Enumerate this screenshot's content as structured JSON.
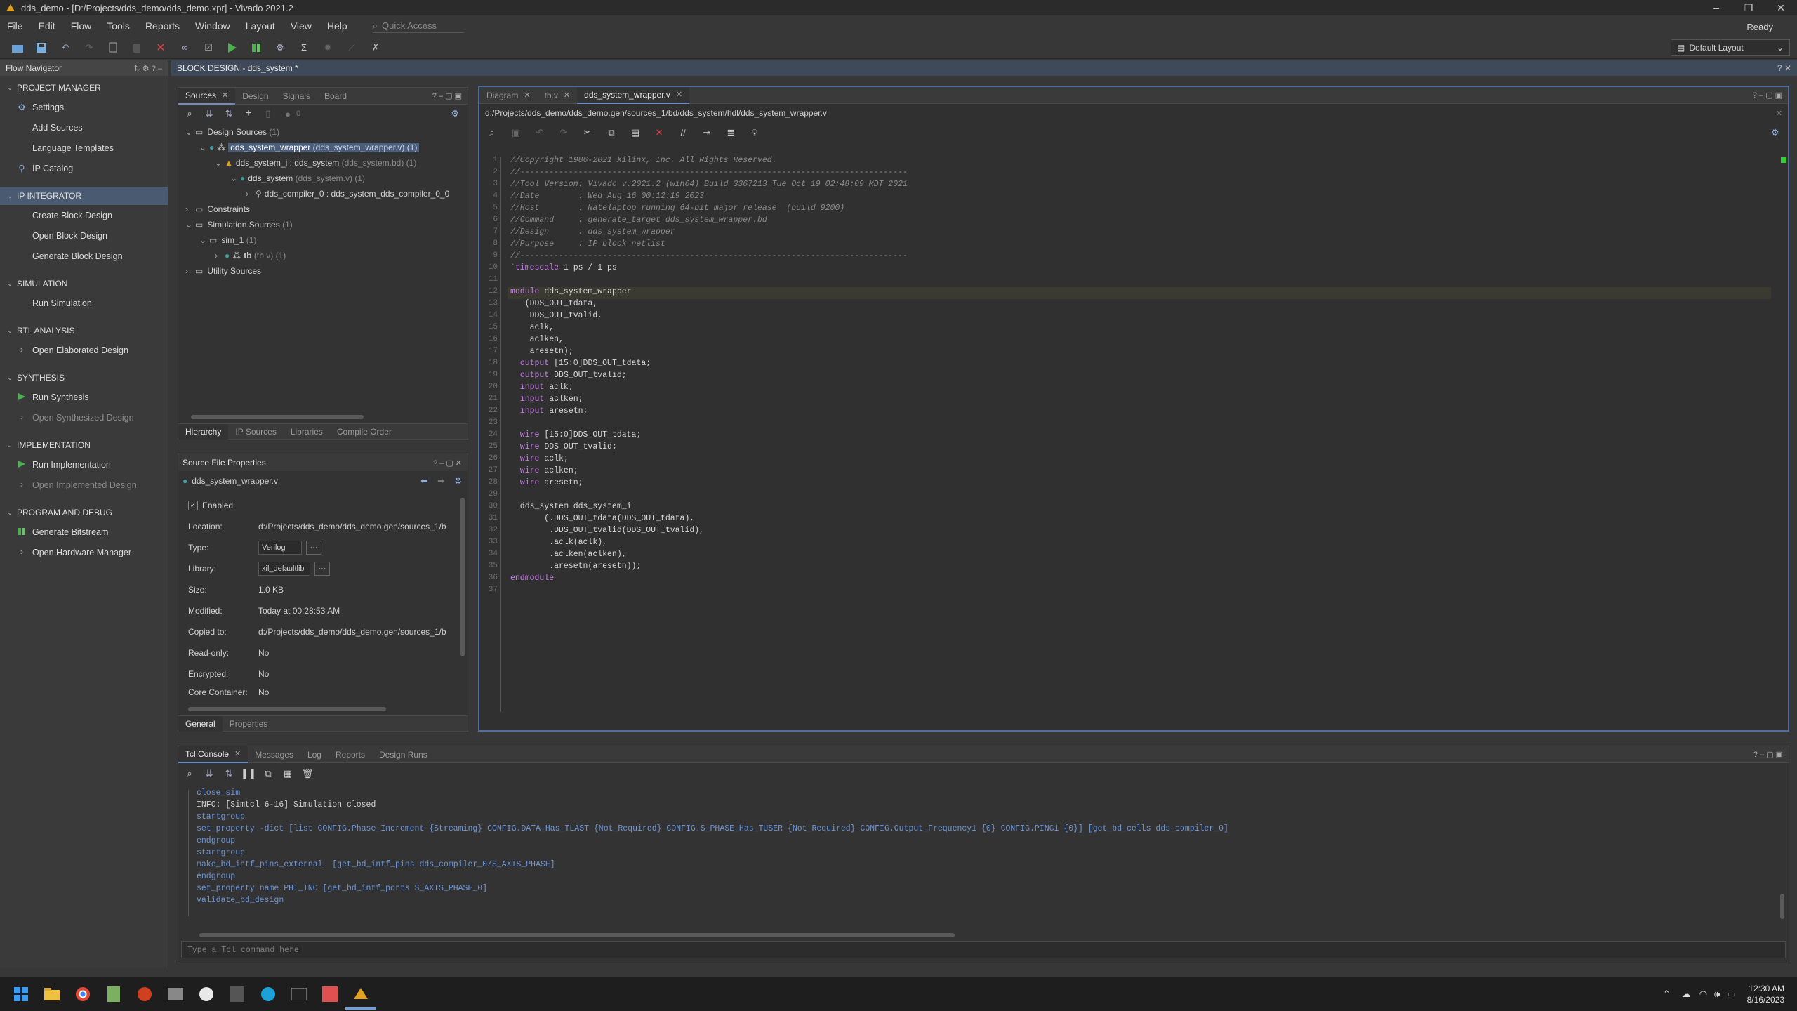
{
  "titlebar": {
    "title": "dds_demo - [D:/Projects/dds_demo/dds_demo.xpr] - Vivado 2021.2"
  },
  "menubar": {
    "items": [
      "File",
      "Edit",
      "Flow",
      "Tools",
      "Reports",
      "Window",
      "Layout",
      "View",
      "Help"
    ],
    "quick_access": "Quick Access",
    "status": "Ready"
  },
  "toolbar": {
    "layout_selector": "Default Layout"
  },
  "flow_navigator": {
    "title": "Flow Navigator",
    "sections": [
      {
        "title": "PROJECT MANAGER",
        "items": [
          "Settings",
          "Add Sources",
          "Language Templates",
          "IP Catalog"
        ]
      },
      {
        "title": "IP INTEGRATOR",
        "items": [
          "Create Block Design",
          "Open Block Design",
          "Generate Block Design"
        ]
      },
      {
        "title": "SIMULATION",
        "items": [
          "Run Simulation"
        ]
      },
      {
        "title": "RTL ANALYSIS",
        "items": [
          "Open Elaborated Design"
        ]
      },
      {
        "title": "SYNTHESIS",
        "items": [
          "Run Synthesis",
          "Open Synthesized Design"
        ]
      },
      {
        "title": "IMPLEMENTATION",
        "items": [
          "Run Implementation",
          "Open Implemented Design"
        ]
      },
      {
        "title": "PROGRAM AND DEBUG",
        "items": [
          "Generate Bitstream",
          "Open Hardware Manager"
        ]
      }
    ]
  },
  "block_design": {
    "header": "BLOCK DESIGN - dds_system *"
  },
  "sources": {
    "tabs": [
      "Sources",
      "Design",
      "Signals",
      "Board"
    ],
    "badge": "0",
    "tree": {
      "design_sources": "Design Sources",
      "design_sources_count": "(1)",
      "wrapper_name": "dds_system_wrapper",
      "wrapper_file": "(dds_system_wrapper.v) (1)",
      "inst_name": "dds_system_i : dds_system",
      "inst_file": "(dds_system.bd) (1)",
      "sys_name": "dds_system",
      "sys_file": "(dds_system.v) (1)",
      "comp_name": "dds_compiler_0 : dds_system_dds_compiler_0_0",
      "constraints": "Constraints",
      "sim_sources": "Simulation Sources",
      "sim_sources_count": "(1)",
      "sim_1": "sim_1",
      "sim_1_count": "(1)",
      "tb_name": "tb",
      "tb_file": "(tb.v) (1)",
      "utility": "Utility Sources"
    },
    "bottom_tabs": [
      "Hierarchy",
      "IP Sources",
      "Libraries",
      "Compile Order"
    ]
  },
  "props": {
    "title": "Source File Properties",
    "file": "dds_system_wrapper.v",
    "enabled": "Enabled",
    "rows": [
      {
        "k": "Location:",
        "v": "d:/Projects/dds_demo/dds_demo.gen/sources_1/b"
      },
      {
        "k": "Type:",
        "v": "Verilog"
      },
      {
        "k": "Library:",
        "v": "xil_defaultlib"
      },
      {
        "k": "Size:",
        "v": "1.0 KB"
      },
      {
        "k": "Modified:",
        "v": "Today at 00:28:53 AM"
      },
      {
        "k": "Copied to:",
        "v": "d:/Projects/dds_demo/dds_demo.gen/sources_1/b"
      },
      {
        "k": "Read-only:",
        "v": "No"
      },
      {
        "k": "Encrypted:",
        "v": "No"
      },
      {
        "k": "Core Container:",
        "v": "No"
      }
    ],
    "bottom_tabs": [
      "General",
      "Properties"
    ]
  },
  "editor": {
    "tabs": [
      "Diagram",
      "tb.v",
      "dds_system_wrapper.v"
    ],
    "path": "d:/Projects/dds_demo/dds_demo.gen/sources_1/bd/dds_system/hdl/dds_system_wrapper.v",
    "lines": [
      "//Copyright 1986-2021 Xilinx, Inc. All Rights Reserved.",
      "//--------------------------------------------------------------------------------",
      "//Tool Version: Vivado v.2021.2 (win64) Build 3367213 Tue Oct 19 02:48:09 MDT 2021",
      "//Date        : Wed Aug 16 00:12:19 2023",
      "//Host        : Natelaptop running 64-bit major release  (build 9200)",
      "//Command     : generate_target dds_system_wrapper.bd",
      "//Design      : dds_system_wrapper",
      "//Purpose     : IP block netlist",
      "//--------------------------------------------------------------------------------",
      "`timescale 1 ps / 1 ps",
      "",
      "module dds_system_wrapper",
      "   (DDS_OUT_tdata,",
      "    DDS_OUT_tvalid,",
      "    aclk,",
      "    aclken,",
      "    aresetn);",
      "  output [15:0]DDS_OUT_tdata;",
      "  output DDS_OUT_tvalid;",
      "  input aclk;",
      "  input aclken;",
      "  input aresetn;",
      "",
      "  wire [15:0]DDS_OUT_tdata;",
      "  wire DDS_OUT_tvalid;",
      "  wire aclk;",
      "  wire aclken;",
      "  wire aresetn;",
      "",
      "  dds_system dds_system_i",
      "       (.DDS_OUT_tdata(DDS_OUT_tdata),",
      "        .DDS_OUT_tvalid(DDS_OUT_tvalid),",
      "        .aclk(aclk),",
      "        .aclken(aclken),",
      "        .aresetn(aresetn));",
      "endmodule",
      ""
    ]
  },
  "console": {
    "tabs": [
      "Tcl Console",
      "Messages",
      "Log",
      "Reports",
      "Design Runs"
    ],
    "lines": [
      "close_sim",
      "INFO: [Simtcl 6-16] Simulation closed",
      "startgroup",
      "set_property -dict [list CONFIG.Phase_Increment {Streaming} CONFIG.DATA_Has_TLAST {Not_Required} CONFIG.S_PHASE_Has_TUSER {Not_Required} CONFIG.Output_Frequency1 {0} CONFIG.PINC1 {0}] [get_bd_cells dds_compiler_0]",
      "endgroup",
      "startgroup",
      "make_bd_intf_pins_external  [get_bd_intf_pins dds_compiler_0/S_AXIS_PHASE]",
      "endgroup",
      "set_property name PHI_INC [get_bd_intf_ports S_AXIS_PHASE_0]",
      "validate_bd_design"
    ],
    "input_placeholder": "Type a Tcl command here"
  },
  "taskbar": {
    "time": "12:30 AM",
    "date": "8/16/2023"
  },
  "colors": {
    "accent": "#4e6e9e",
    "selection": "#4b5d78",
    "comment": "#8a8a8a",
    "keyword": "#c080e0",
    "console_cmd": "#6c95d8"
  }
}
